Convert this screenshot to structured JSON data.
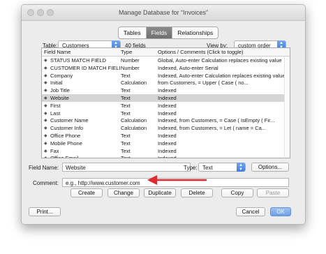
{
  "window": {
    "title": "Manage Database for “Invoices”"
  },
  "tabs": [
    {
      "label": "Tables",
      "selected": false
    },
    {
      "label": "Fields",
      "selected": true
    },
    {
      "label": "Relationships",
      "selected": false
    }
  ],
  "table": {
    "label": "Table:",
    "value": "Customers",
    "count": "40 fields"
  },
  "view_by": {
    "label": "View by:",
    "value": "custom order"
  },
  "columns": {
    "name": "Field Name",
    "type": "Type",
    "options": "Options / Comments   (Click to toggle)"
  },
  "fields": [
    {
      "name": "STATUS MATCH FIELD",
      "type": "Number",
      "options": "Global, Auto-enter Calculation replaces existing value"
    },
    {
      "name": "CUSTOMER ID MATCH FIELD",
      "type": "Number",
      "options": "Indexed, Auto-enter Serial"
    },
    {
      "name": "Company",
      "type": "Text",
      "options": "Indexed, Auto-enter Calculation replaces existing value"
    },
    {
      "name": "Initial",
      "type": "Calculation",
      "options": "from Customers, = Upper (          Case       (              no..."
    },
    {
      "name": "Job Title",
      "type": "Text",
      "options": "Indexed"
    },
    {
      "name": "Website",
      "type": "Text",
      "options": "Indexed"
    },
    {
      "name": "First",
      "type": "Text",
      "options": "Indexed"
    },
    {
      "name": "Last",
      "type": "Text",
      "options": "Indexed"
    },
    {
      "name": "Customer Name",
      "type": "Calculation",
      "options": "Indexed, from Customers, = Case      (             IsEmpty ( Fir..."
    },
    {
      "name": "Customer Info",
      "type": "Calculation",
      "options": "Indexed, from Customers, = Let      (             name =     Ca..."
    },
    {
      "name": "Office Phone",
      "type": "Text",
      "options": "Indexed"
    },
    {
      "name": "Mobile Phone",
      "type": "Text",
      "options": "Indexed"
    },
    {
      "name": "Fax",
      "type": "Text",
      "options": "Indexed"
    },
    {
      "name": "Office Email",
      "type": "Text",
      "options": "Indexed"
    }
  ],
  "selected_index": 5,
  "field_name": {
    "label": "Field Name:",
    "value": "Website"
  },
  "type": {
    "label": "Type:",
    "value": "Text"
  },
  "options_button": "Options...",
  "comment": {
    "label": "Comment:",
    "value": "e.g., http://www.customer.com"
  },
  "actions": {
    "create": "Create",
    "change": "Change",
    "duplicate": "Duplicate",
    "delete": "Delete",
    "copy": "Copy",
    "paste": "Paste"
  },
  "footer": {
    "print": "Print...",
    "cancel": "Cancel",
    "ok": "OK"
  },
  "colors": {
    "annotation_arrow": "#e0282f",
    "ok_button": "#6e9ee6",
    "selected_row": "#d5d5d5"
  }
}
